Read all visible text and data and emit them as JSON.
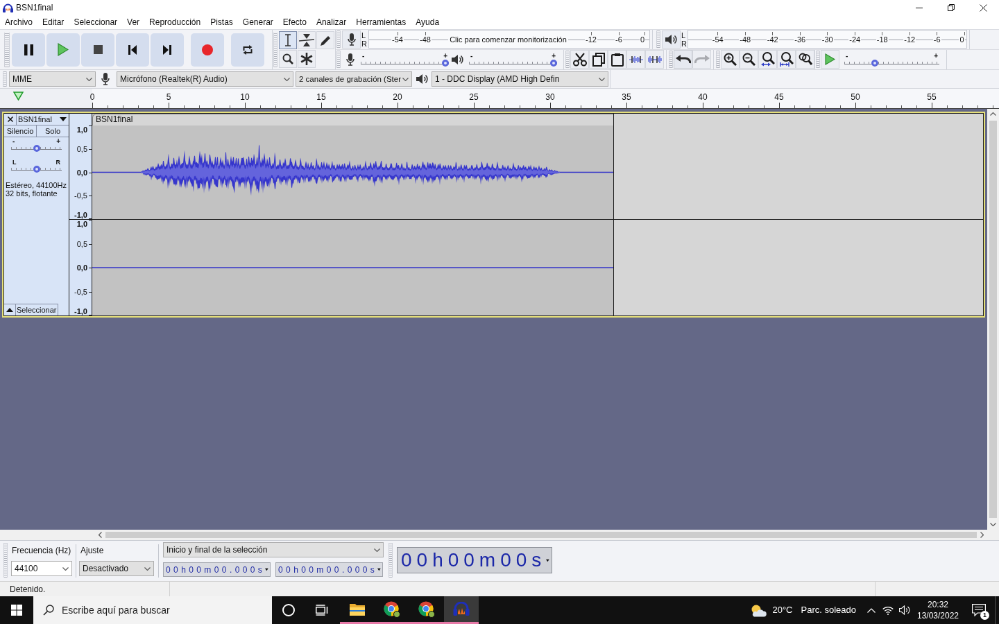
{
  "window": {
    "title": "BSN1final"
  },
  "menu_bar": [
    "Archivo",
    "Editar",
    "Seleccionar",
    "Ver",
    "Reproducción",
    "Pistas",
    "Generar",
    "Efecto",
    "Analizar",
    "Herramientas",
    "Ayuda"
  ],
  "tools": [
    {
      "kind": "select",
      "selected": true
    },
    {
      "kind": "envelope",
      "selected": false
    },
    {
      "kind": "draw",
      "selected": false
    },
    {
      "kind": "zoom",
      "selected": false
    },
    {
      "kind": "multi",
      "selected": false
    }
  ],
  "recording_meter": {
    "channels": [
      "L",
      "R"
    ],
    "ticks_before": [
      "-54",
      "-48"
    ],
    "prompt": "Clic para comenzar monitorización",
    "ticks_after": [
      "-12",
      "-6",
      "0"
    ]
  },
  "playback_meter": {
    "channels": [
      "L",
      "R"
    ],
    "ticks": [
      "-54",
      "-48",
      "-42",
      "-36",
      "-30",
      "-24",
      "-18",
      "-12",
      "-6",
      "0"
    ]
  },
  "recording_volume": {
    "min_label": "-",
    "max_label": "+",
    "level": 1
  },
  "playback_volume": {
    "min_label": "-",
    "max_label": "+",
    "level": 1
  },
  "history": [
    {
      "kind": "undo",
      "disabled": false
    },
    {
      "kind": "redo",
      "disabled": true
    }
  ],
  "play_at_speed": {
    "min_label": "-",
    "max_label": "+",
    "level": 0.31
  },
  "devices": {
    "host": "MME",
    "input": "Micrófono (Realtek(R) Audio)",
    "channels": "2 canales de grabación (Ster",
    "output": "1 - DDC Display (AMD High Defin"
  },
  "timeline": {
    "labels": [
      "0",
      "5",
      "10",
      "15",
      "20",
      "25",
      "30",
      "35",
      "40",
      "45",
      "50",
      "55"
    ]
  },
  "track": {
    "name": "BSN1final",
    "mute": "Silencio",
    "solo": "Solo",
    "gain": {
      "min_label": "-",
      "max_label": "+",
      "level": 0.5
    },
    "pan": {
      "min_label": "L",
      "max_label": "R",
      "level": 0.5
    },
    "info": [
      "Estéreo, 44100Hz",
      "32 bits, flotante"
    ],
    "select_button": "Seleccionar",
    "clip_title": "BSN1final",
    "channels": [
      {
        "kind": "waveform",
        "scale": [
          {
            "label": "1,0",
            "major": true
          },
          {
            "label": "0,5",
            "major": false
          },
          {
            "label": "0,0",
            "major": true
          },
          {
            "label": "-0,5",
            "major": false
          },
          {
            "label": "-1,0",
            "major": true
          }
        ]
      },
      {
        "kind": "silent",
        "scale": [
          {
            "label": "1,0",
            "major": true
          },
          {
            "label": "0,5",
            "major": false
          },
          {
            "label": "0,0",
            "major": true
          },
          {
            "label": "-0,5",
            "major": false
          },
          {
            "label": "-1,0",
            "major": true
          }
        ]
      }
    ]
  },
  "selection_toolbar": {
    "rate_label": "Frecuencia (Hz)",
    "rate": "44100",
    "snap_label": "Ajuste",
    "snap": "Desactivado",
    "mode": "Inicio y final de la selección",
    "start": "00h00m00.000s",
    "end": "00h00m00.000s"
  },
  "time_display": "00h00m00s",
  "status_bar": {
    "text": "Detenido."
  },
  "taskbar": {
    "search_placeholder": "Escribe aquí para buscar",
    "apps": [
      {
        "kind": "folder",
        "selected": false
      },
      {
        "kind": "browser",
        "selected": false
      },
      {
        "kind": "browser",
        "selected": false
      },
      {
        "kind": "audio_editor",
        "selected": true
      }
    ],
    "weather": {
      "temperature": "20°C",
      "condition": "Parc. soleado"
    },
    "clock": {
      "time": "20:32",
      "date": "13/03/2022"
    },
    "notification_count": "1"
  }
}
